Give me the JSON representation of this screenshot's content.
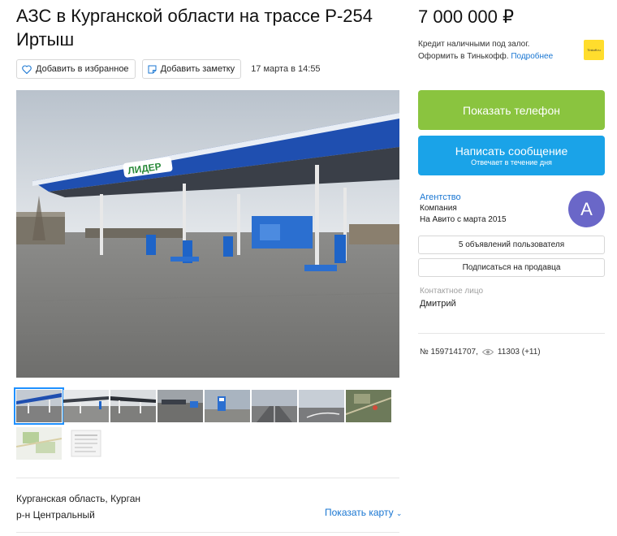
{
  "listing": {
    "title": "АЗС в Курганской области на трассе Р-254 Иртыш",
    "add_favorite_label": "Добавить в избранное",
    "add_note_label": "Добавить заметку",
    "date": "17 марта в 14:55"
  },
  "location": {
    "line1": "Курганская область, Курган",
    "line2": "р-н Центральный",
    "show_map_label": "Показать карту"
  },
  "gallery": {
    "canopy_brand": "ЛИДЕР",
    "thumbnail_count": 10,
    "active_index": 0
  },
  "sidebar": {
    "price": "7 000 000 ₽",
    "credit_line1": "Кредит наличными под залог.",
    "credit_line2": "Оформить в Тинькофф.",
    "credit_more": "Подробнее",
    "bank_logo_text": "Tinkoff.ru",
    "show_phone_label": "Показать телефон",
    "write_message_label": "Написать сообщение",
    "write_message_sub": "Отвечает в течение дня",
    "seller_name": "Агентство",
    "seller_type": "Компания",
    "seller_since": "На Авито с марта 2015",
    "avatar_letter": "А",
    "listings_button": "5 объявлений пользователя",
    "subscribe_button": "Подписаться на продавца",
    "contact_label": "Контактное лицо",
    "contact_name": "Дмитрий",
    "listing_number": "№ 1597141707,",
    "views": "11303 (+11)"
  },
  "colors": {
    "phone_button": "#8ac43f",
    "message_button": "#1aa3e8",
    "link": "#1976d2",
    "avatar": "#6a67c8"
  }
}
